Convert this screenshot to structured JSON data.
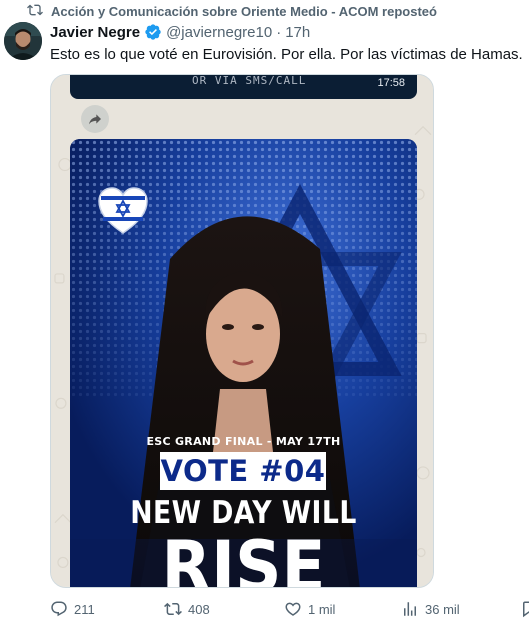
{
  "social_context": {
    "text": "Acción y Comunicación sobre Oriente Medio - ACOM reposteó",
    "icon": "repost-icon"
  },
  "author": {
    "name": "Javier Negre",
    "handle": "@javiernegre10",
    "separator": "·",
    "time": "17h",
    "verified_color": "#1d9bf0"
  },
  "tweet": {
    "text": "Esto es lo que voté en Eurovisión. Por ella. Por las víctimas de Hamas."
  },
  "media": {
    "banner_text": "OR VIA SMS/CALL",
    "banner_time": "17:58",
    "poster": {
      "final_text": "ESC GRAND FINAL - MAY 17TH",
      "vote_text": "VOTE #04",
      "song_line1": "NEW DAY WILL",
      "song_line2": "RISE"
    }
  },
  "actions": {
    "replies": "211",
    "reposts": "408",
    "likes": "1 mil",
    "views": "36 mil"
  },
  "colors": {
    "text_primary": "#0f1419",
    "text_secondary": "#536471",
    "accent": "#1d9bf0",
    "poster_blue": "#0c2a8a"
  }
}
